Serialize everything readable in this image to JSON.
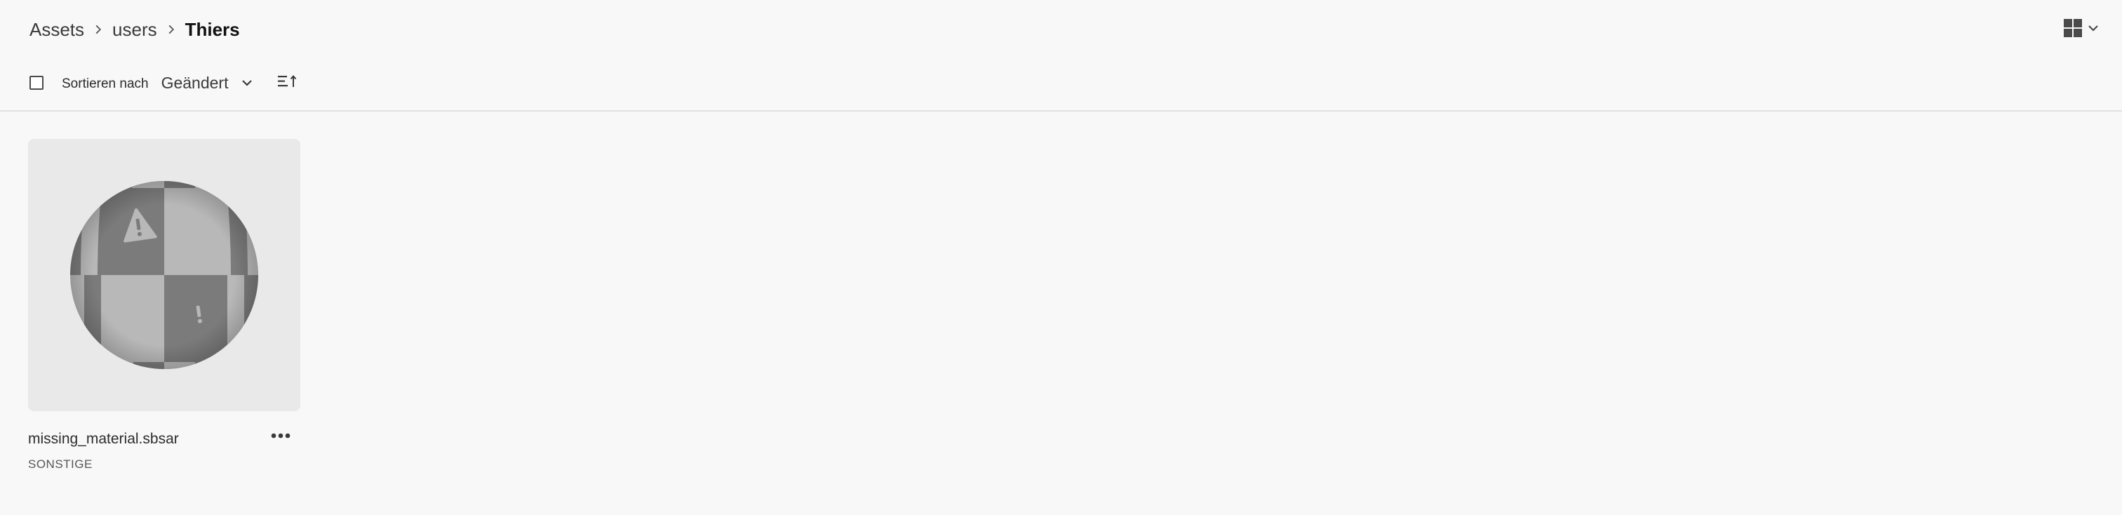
{
  "breadcrumb": {
    "items": [
      "Assets",
      "users"
    ],
    "current": "Thiers"
  },
  "view_switcher": {
    "icon": "grid-view-icon",
    "dropdown_icon": "chevron-down-icon"
  },
  "toolbar": {
    "sort_label": "Sortieren nach",
    "sort_value": "Geändert",
    "sort_order_icon": "sort-order-icon"
  },
  "assets": [
    {
      "name": "missing_material.sbsar",
      "type": "SONSTIGE",
      "thumbnail_icon": "missing-material-sphere"
    }
  ],
  "colors": {
    "background": "#f8f8f8",
    "thumbnail_bg": "#e9e9e9",
    "checker_dark": "#7a7a7a",
    "checker_light": "#b9b9b9"
  }
}
